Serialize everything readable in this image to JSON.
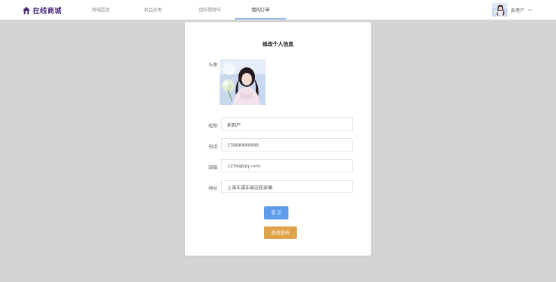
{
  "header": {
    "logo_text": "在线商城",
    "logo_icon": "home-icon",
    "nav": [
      {
        "label": "商城首页",
        "active": false
      },
      {
        "label": "商品分类",
        "active": false
      },
      {
        "label": "我的购物车",
        "active": false
      },
      {
        "label": "我的订单",
        "active": true
      }
    ],
    "user_name": "新用户",
    "user_menu_icon": "chevron-down-icon"
  },
  "profile": {
    "title": "修改个人信息",
    "avatar_label": "头像",
    "nickname_label": "昵称",
    "nickname_value": "新用户",
    "phone_label": "电话",
    "phone_value": "15888888888",
    "email_label": "邮箱",
    "email_value": "1234@qq.com",
    "address_label": "地址",
    "address_value": "上海市浦东新区陆家嘴",
    "submit_label": "提 交",
    "change_password_label": "修改密码"
  },
  "colors": {
    "brand": "#4b2a7a",
    "primary_button": "#5e9bec",
    "warning_button": "#e0a44a",
    "nav_active_underline": "#8fb3e4",
    "page_background": "#d4d4d4"
  }
}
